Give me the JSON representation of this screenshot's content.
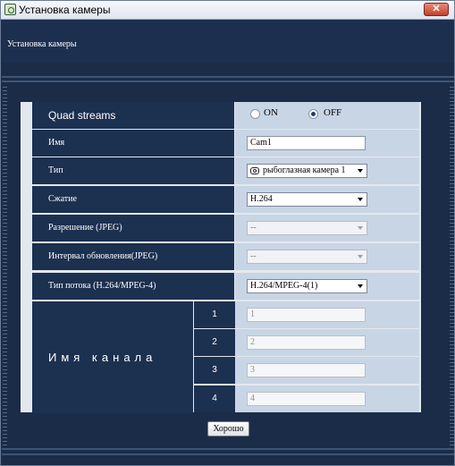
{
  "window": {
    "title": "Установка камеры",
    "close_label": "✕"
  },
  "header": {
    "title": "Установка камеры"
  },
  "form": {
    "quad_streams": {
      "label": "Quad streams",
      "on_label": "ON",
      "off_label": "OFF",
      "selected": "OFF"
    },
    "name": {
      "label": "Имя",
      "value": "Cam1"
    },
    "type": {
      "label": "Тип",
      "value": "рыбоглазная камера 1"
    },
    "compression": {
      "label": "Сжатие",
      "value": "H.264"
    },
    "resolution": {
      "label": "Разрешение (JPEG)",
      "value": "--"
    },
    "refresh_interval": {
      "label": "Интервал обновления(JPEG)",
      "value": "--"
    },
    "stream_type": {
      "label": "Тип потока (H.264/MPEG-4)",
      "value": "H.264/MPEG-4(1)"
    },
    "channel_name": {
      "label": "Имя канала",
      "channels": [
        {
          "num": "1",
          "value": "1"
        },
        {
          "num": "2",
          "value": "2"
        },
        {
          "num": "3",
          "value": "3"
        },
        {
          "num": "4",
          "value": "4"
        }
      ]
    }
  },
  "buttons": {
    "ok_label": "Хорошо"
  }
}
